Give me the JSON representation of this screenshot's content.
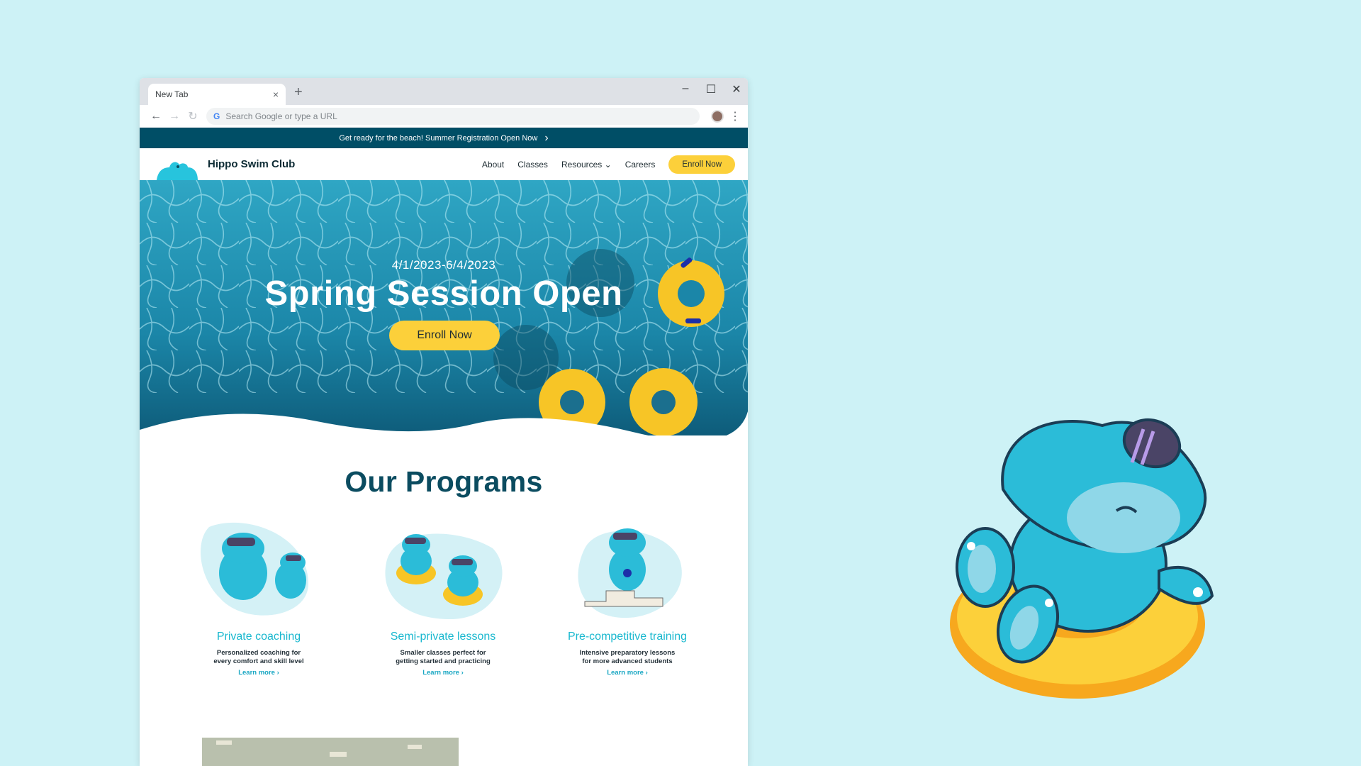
{
  "browser": {
    "tab_title": "New Tab",
    "tab_close": "×",
    "new_tab": "+",
    "omnibox_placeholder": "Search Google or type a URL",
    "controls": {
      "minimize": "–",
      "maximize": "☐",
      "close": "✕"
    },
    "nav": {
      "back": "←",
      "forward": "→",
      "reload": "↻",
      "menu": "⋮"
    }
  },
  "site": {
    "announcement": "Get ready for the beach! Summer Registration Open Now",
    "announcement_chevron": "›",
    "brand": "Hippo Swim Club",
    "nav": {
      "about": "About",
      "classes": "Classes",
      "resources": "Resources",
      "resources_chevron": "⌄",
      "careers": "Careers",
      "enroll": "Enroll Now"
    },
    "hero": {
      "dates": "4/1/2023-6/4/2023",
      "title": "Spring Session Open",
      "cta": "Enroll Now"
    },
    "programs": {
      "title": "Our Programs",
      "items": [
        {
          "title": "Private coaching",
          "desc_line1": "Personalized coaching for",
          "desc_line2": "every comfort and skill level",
          "link": "Learn more ›"
        },
        {
          "title": "Semi-private lessons",
          "desc_line1": "Smaller classes perfect for",
          "desc_line2": "getting started and practicing",
          "link": "Learn more ›"
        },
        {
          "title": "Pre-competitive training",
          "desc_line1": "Intensive preparatory lessons",
          "desc_line2": "for more advanced students",
          "link": "Learn more ›"
        }
      ]
    }
  },
  "colors": {
    "page_bg": "#cdf2f6",
    "banner": "#004e66",
    "accent_yellow": "#fcd03a",
    "program_title": "#0b4c60",
    "card_title": "#19b8cf",
    "hippo_blue": "#2bbcd8"
  }
}
